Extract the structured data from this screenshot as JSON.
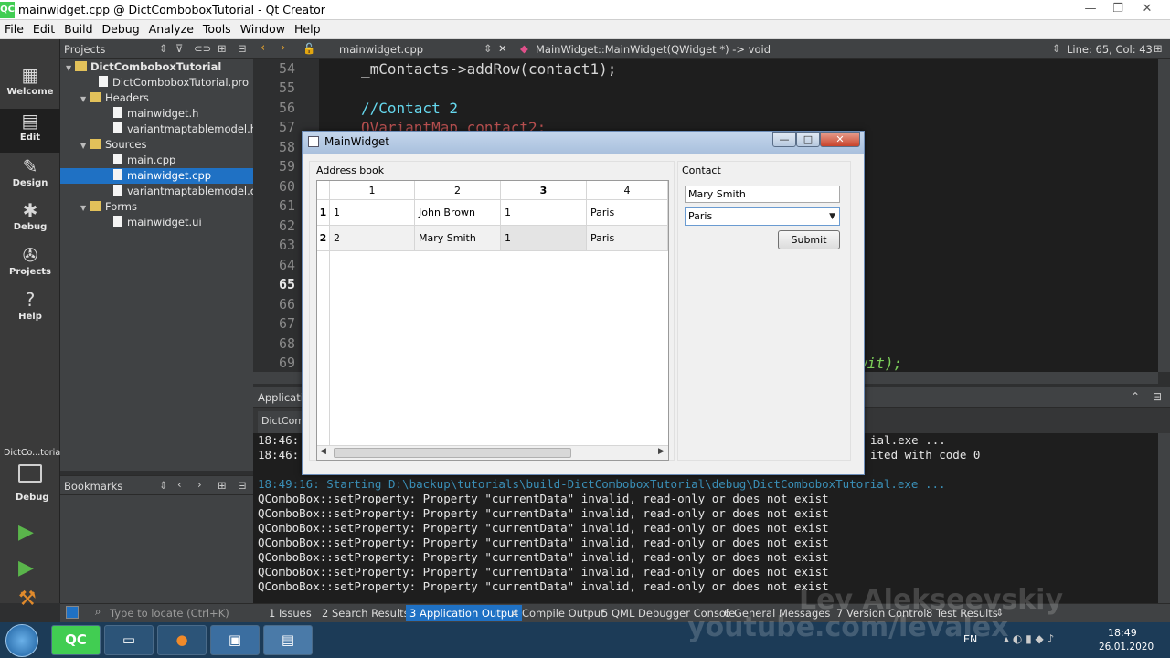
{
  "window": {
    "title": "mainwidget.cpp @ DictComboboxTutorial - Qt Creator",
    "minimize": "—",
    "maximize": "❐",
    "close": "✕"
  },
  "menu": [
    "File",
    "Edit",
    "Build",
    "Debug",
    "Analyze",
    "Tools",
    "Window",
    "Help"
  ],
  "modes": [
    "Welcome",
    "Edit",
    "Design",
    "Debug",
    "Projects",
    "Help"
  ],
  "kit": {
    "name": "DictCo...torial",
    "mode": "Debug"
  },
  "projects": {
    "header": "Projects",
    "tree": {
      "project": "DictComboboxTutorial",
      "pro_file": "DictComboboxTutorial.pro",
      "headers_label": "Headers",
      "headers": [
        "mainwidget.h",
        "variantmaptablemodel.h"
      ],
      "sources_label": "Sources",
      "sources": [
        "main.cpp",
        "mainwidget.cpp",
        "variantmaptablemodel.cpp"
      ],
      "forms_label": "Forms",
      "forms": [
        "mainwidget.ui"
      ]
    }
  },
  "bookmarks": {
    "header": "Bookmarks"
  },
  "editor": {
    "file_tab": "mainwidget.cpp",
    "function": "MainWidget::MainWidget(QWidget *) -> void",
    "position": "Line: 65, Col: 43",
    "line_numbers": [
      "54",
      "55",
      "56",
      "57",
      "58",
      "59",
      "60",
      "61",
      "62",
      "63",
      "64",
      "65",
      "66",
      "67",
      "68",
      "69"
    ],
    "lines": [
      {
        "text": "_mContacts->addRow(contact1);",
        "color": "#d6d6d6"
      },
      {
        "text": "",
        "color": "#d6d6d6"
      },
      {
        "text": "//Contact 2",
        "color": "#66d9ef"
      },
      {
        "text": "QVariantMap contact2;",
        "color": "#d6d6d6"
      }
    ],
    "partial_tail": "wit);"
  },
  "output": {
    "header": "Application Output",
    "tab": "DictComb",
    "earlier": [
      {
        "time": "18:46:",
        "tail": "ial.exe ..."
      },
      {
        "time": "18:46:",
        "tail": "ited with code 0"
      }
    ],
    "start_line": "18:49:16: Starting D:\\backup\\tutorials\\build-DictComboboxTutorial\\debug\\DictComboboxTutorial.exe ...",
    "messages": [
      "QComboBox::setProperty: Property \"currentData\" invalid, read-only or does not exist",
      "QComboBox::setProperty: Property \"currentData\" invalid, read-only or does not exist",
      "QComboBox::setProperty: Property \"currentData\" invalid, read-only or does not exist",
      "QComboBox::setProperty: Property \"currentData\" invalid, read-only or does not exist",
      "QComboBox::setProperty: Property \"currentData\" invalid, read-only or does not exist",
      "QComboBox::setProperty: Property \"currentData\" invalid, read-only or does not exist",
      "QComboBox::setProperty: Property \"currentData\" invalid, read-only or does not exist"
    ]
  },
  "statusbar": {
    "locate_placeholder": "Type to locate (Ctrl+K)",
    "panes": [
      "1  Issues",
      "2  Search Results",
      "3  Application Output",
      "4  Compile Output",
      "5  QML Debugger Console",
      "6  General Messages",
      "7  Version Control",
      "8  Test Results"
    ],
    "watermark_name": "Lev Alekseevskiy",
    "watermark_url": "youtube.com/levalex"
  },
  "dialog": {
    "title": "MainWidget",
    "address_book_label": "Address book",
    "columns": [
      "1",
      "2",
      "3",
      "4"
    ],
    "rows": [
      {
        "header": "1",
        "cells": [
          "1",
          "John Brown",
          "1",
          "Paris"
        ]
      },
      {
        "header": "2",
        "cells": [
          "2",
          "Mary Smith",
          "1",
          "Paris"
        ]
      }
    ],
    "contact_label": "Contact",
    "name_value": "Mary Smith",
    "city_value": "Paris",
    "submit_label": "Submit"
  },
  "taskbar": {
    "lang": "EN",
    "time": "18:49",
    "date": "26.01.2020",
    "qc_label": "QC"
  },
  "colors": {
    "accent": "#1f71c4",
    "run_green": "#5ab54b",
    "comment": "#66d9ef",
    "output_start": "#3a8fb7"
  }
}
